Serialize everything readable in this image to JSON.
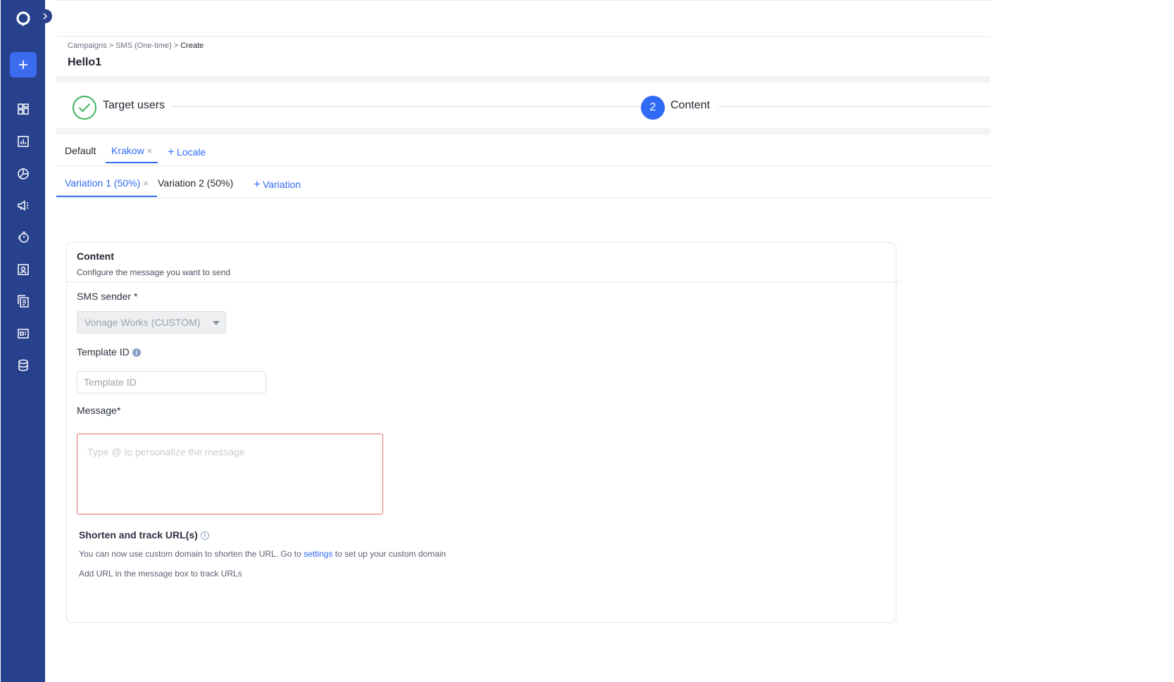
{
  "breadcrumb": {
    "item1": "Campaigns",
    "sep1": ">",
    "item2": "SMS (One-time)",
    "sep2": ">",
    "current": "Create"
  },
  "page_title": "Hello1",
  "steps": {
    "step1_label": "Target users",
    "step2_number": "2",
    "step2_label": "Content"
  },
  "locale_tabs": {
    "default": "Default",
    "krakow": "Krakow",
    "remove_glyph": "×",
    "add_locale": "Locale",
    "plus_glyph": "+"
  },
  "variation_tabs": {
    "variation1": "Variation 1 (50%)",
    "variation2": "Variation 2 (50%)",
    "add_variation": "Variation"
  },
  "content_section": {
    "title": "Content",
    "subtitle": "Configure the message you want to send",
    "sms_sender_label": "SMS sender",
    "required_mark": "*",
    "sms_sender_value": "Vonage Works (CUSTOM)",
    "template_id_label": "Template ID",
    "template_id_placeholder": "Template ID",
    "message_label": "Message",
    "message_placeholder": "Type @ to personalize the message",
    "shorten_title": "Shorten and track URL(s)",
    "note1_prefix": "You can now use custom domain to shorten the URL. Go to",
    "note1_link": "settings",
    "note1_suffix": "to set up your custom domain",
    "note2": "Add URL in the message box to track URLs"
  },
  "icons": {
    "logo": "logo-icon",
    "collapse": "chevron-right-icon",
    "add": "plus-icon",
    "sidebar": [
      "dashboard-icon",
      "analytics-icon",
      "segments-icon",
      "campaigns-icon",
      "flows-icon",
      "users-icon",
      "content-icon",
      "templates-icon",
      "data-icon"
    ]
  },
  "colors": {
    "sidebar_bg": "#28418c",
    "accent": "#2f6bf4",
    "success": "#3cb15a",
    "error_border": "#e86f6f"
  }
}
